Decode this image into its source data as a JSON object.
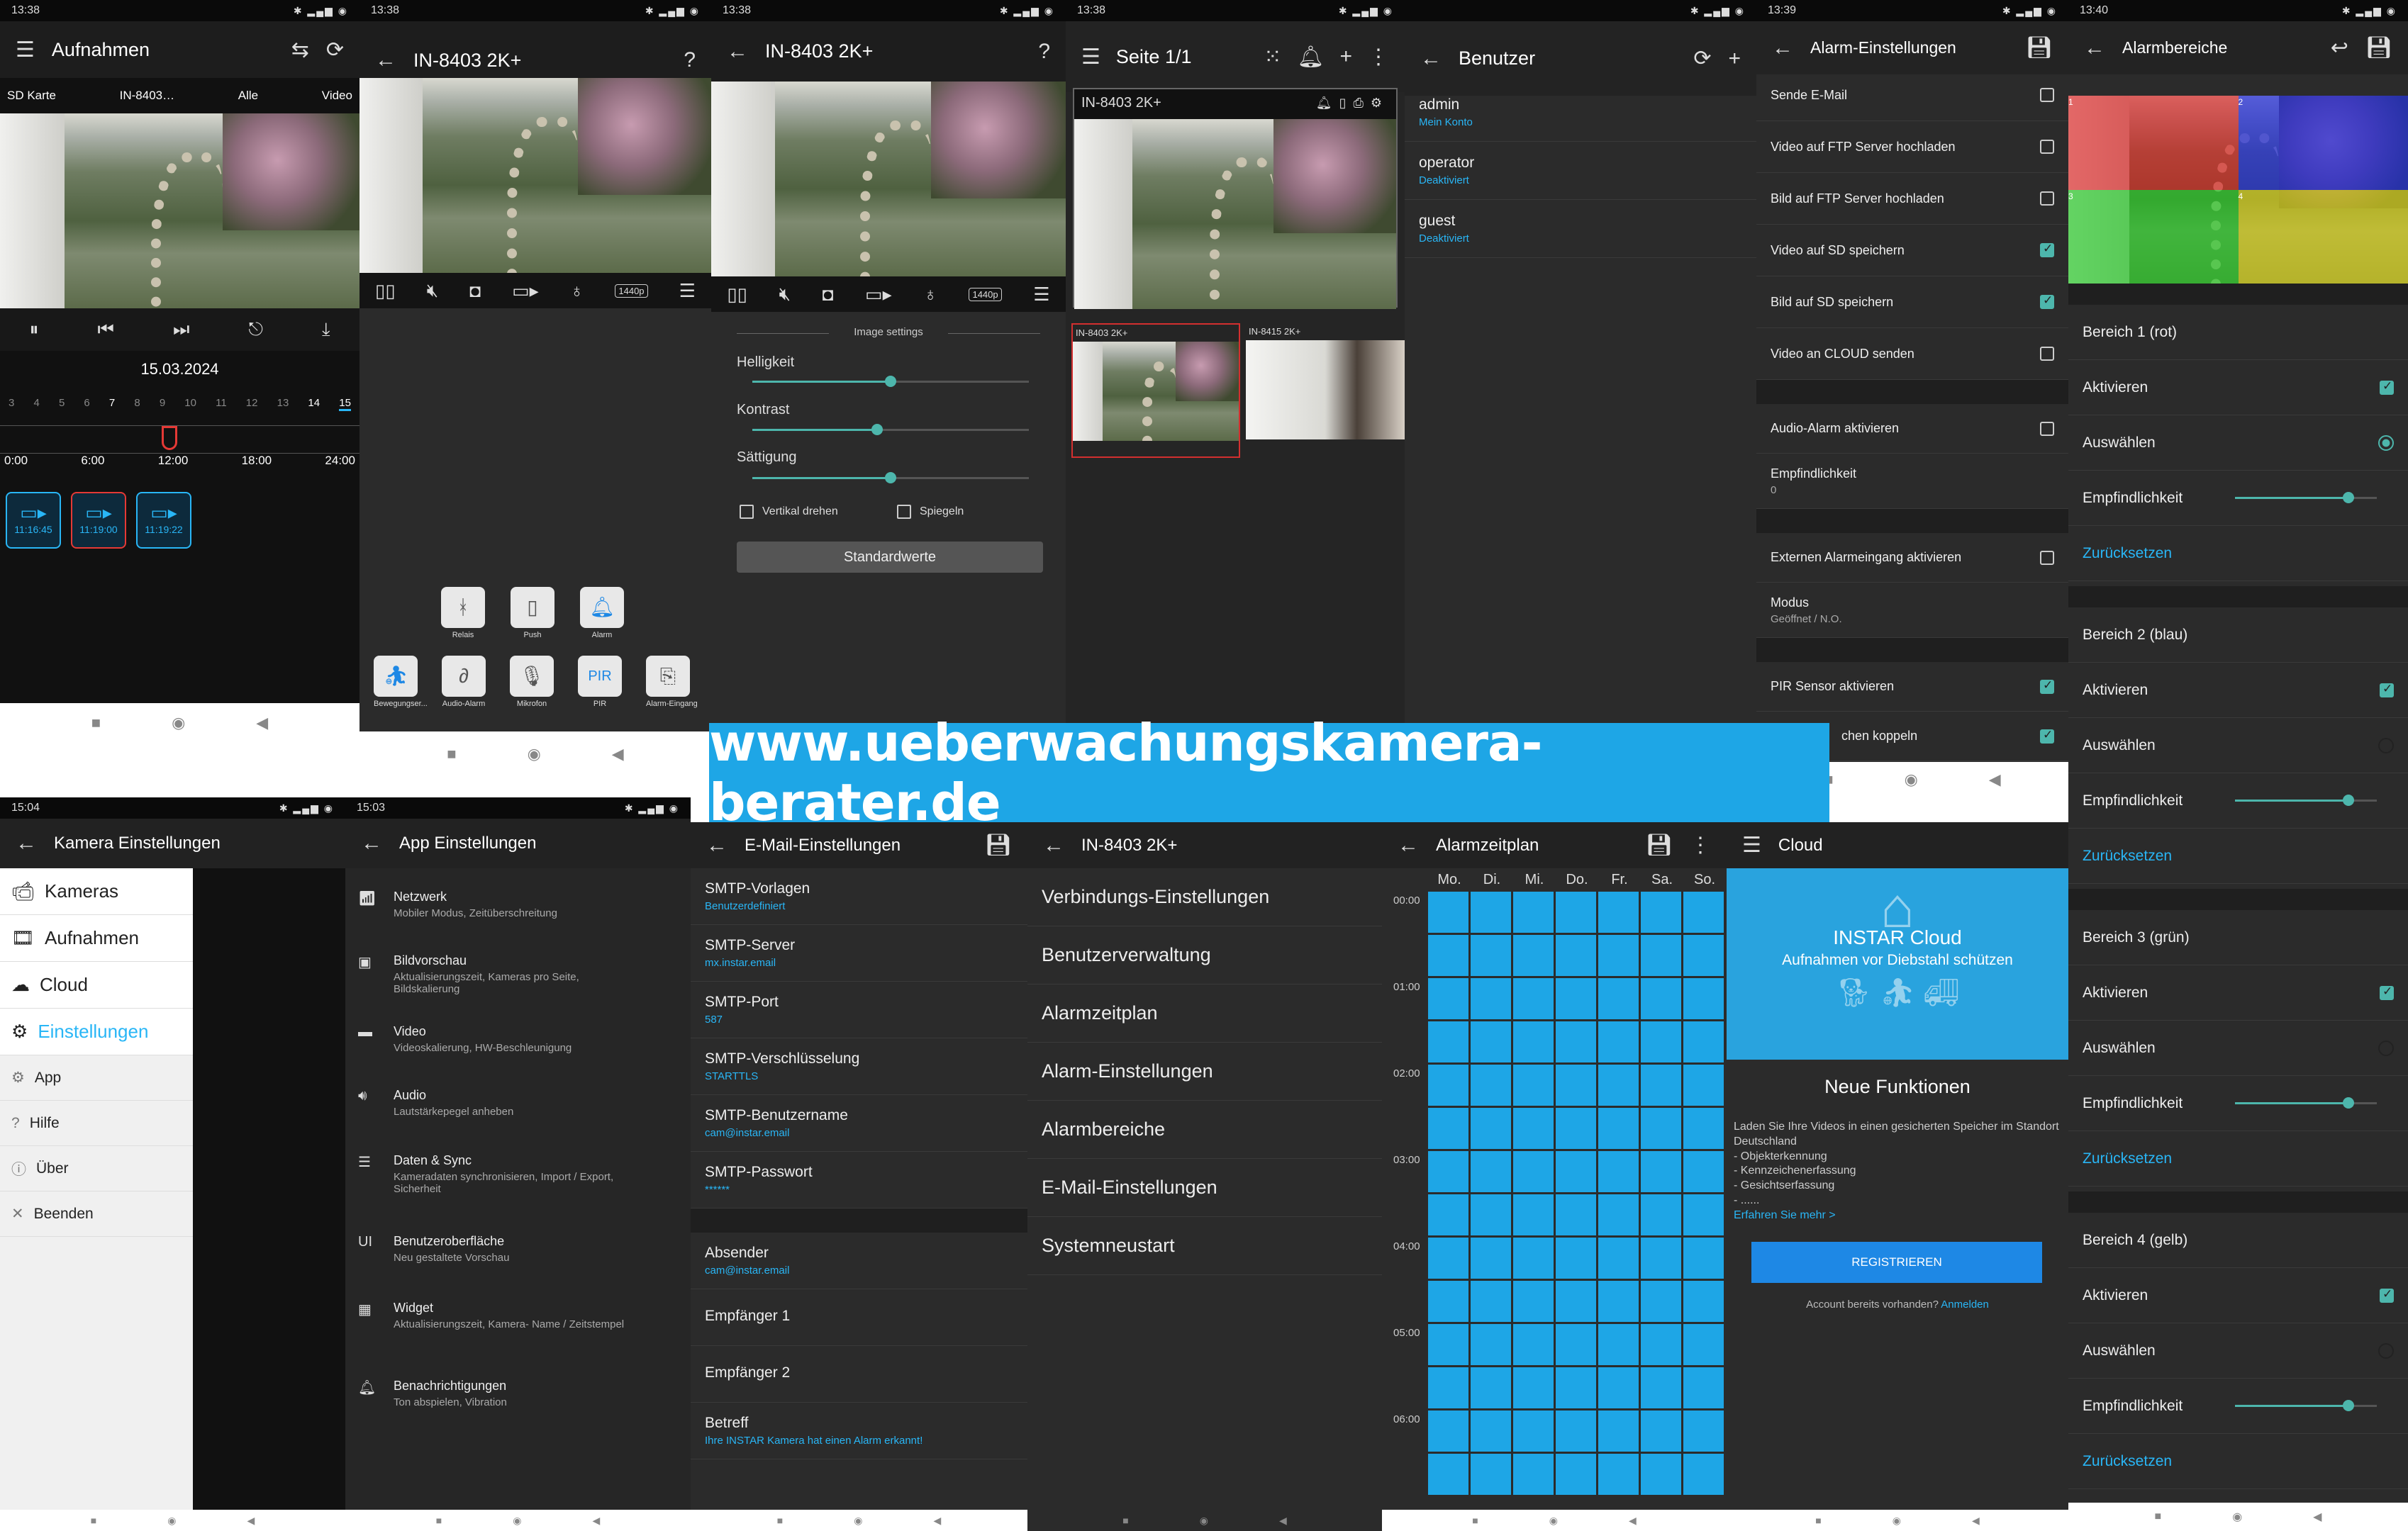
{
  "p1": {
    "time": "13:38",
    "title": "Aufnahmen",
    "filters": [
      "SD Karte",
      "IN-8403…",
      "Alle",
      "Video"
    ],
    "date": "15.03.2024",
    "days": [
      "3",
      "4",
      "5",
      "6",
      "7",
      "8",
      "9",
      "10",
      "11",
      "12",
      "13",
      "14",
      "15"
    ],
    "hours": [
      "0:00",
      "6:00",
      "12:00",
      "18:00",
      "24:00"
    ],
    "clips": [
      "11:16:45",
      "11:19:00",
      "11:19:22"
    ]
  },
  "p2": {
    "time": "13:38",
    "title": "IN-8403 2K+",
    "help": "?",
    "btn_row1": [
      "Relais",
      "Push",
      "Alarm"
    ],
    "btn_row2": [
      "Bewegungser...",
      "Audio-Alarm",
      "Mikrofon",
      "PIR",
      "Alarm-Eingang"
    ],
    "quality": "1440p"
  },
  "p3": {
    "time": "13:38",
    "title": "IN-8403 2K+",
    "help": "?",
    "section": "Image settings",
    "sliders": [
      {
        "label": "Helligkeit",
        "value": 0.5
      },
      {
        "label": "Kontrast",
        "value": 0.45
      },
      {
        "label": "Sättigung",
        "value": 0.5
      }
    ],
    "vflip": "Vertikal drehen",
    "mirror": "Spiegeln",
    "reset": "Standardwerte",
    "quality": "1440p"
  },
  "p4": {
    "time": "13:38",
    "title": "Seite 1/1",
    "cam_name": "IN-8403 2K+",
    "thumbs": [
      "IN-8403 2K+",
      "IN-8415 2K+"
    ]
  },
  "p5": {
    "time": "13:39",
    "title": "Benutzer",
    "users": [
      {
        "name": "admin",
        "sub": "Mein Konto"
      },
      {
        "name": "operator",
        "sub": "Deaktiviert"
      },
      {
        "name": "guest",
        "sub": "Deaktiviert"
      }
    ]
  },
  "p6": {
    "time": "13:39",
    "title": "Alarm-Einstellungen",
    "items": [
      {
        "label": "Sende E-Mail",
        "on": false
      },
      {
        "label": "Video auf FTP Server hochladen",
        "on": false
      },
      {
        "label": "Bild auf FTP Server hochladen",
        "on": false
      },
      {
        "label": "Video auf SD speichern",
        "on": true
      },
      {
        "label": "Bild auf SD speichern",
        "on": true
      },
      {
        "label": "Video an CLOUD senden",
        "on": false
      }
    ],
    "audio": "Audio-Alarm aktivieren",
    "sens": "Empfindlichkeit",
    "sens_val": "0",
    "ext": "Externen Alarmeingang aktivieren",
    "mode": "Modus",
    "mode_val": "Geöffnet / N.O.",
    "pir": "PIR Sensor aktivieren",
    "link": "chen koppeln"
  },
  "p7": {
    "time": "13:40",
    "title": "Alarmbereiche",
    "zones": [
      {
        "title": "Bereich 1 (rot)",
        "selected": true
      },
      {
        "title": "Bereich 2 (blau)",
        "selected": false
      },
      {
        "title": "Bereich 3 (grün)",
        "selected": false
      },
      {
        "title": "Bereich 4 (gelb)",
        "selected": false
      }
    ],
    "active": "Aktivieren",
    "select": "Auswählen",
    "sens": "Empfindlichkeit",
    "reset": "Zurücksetzen",
    "zone_nums": [
      "1",
      "2",
      "3",
      "4"
    ]
  },
  "b1": {
    "time": "15:04",
    "title": "Kamera Einstellungen",
    "menu": [
      "Kameras",
      "Aufnahmen",
      "Cloud",
      "Einstellungen",
      "App",
      "Hilfe",
      "Über",
      "Beenden"
    ]
  },
  "b2": {
    "time": "15:03",
    "title": "App Einstellungen",
    "items": [
      {
        "t": "Netzwerk",
        "s": "Mobiler Modus, Zeitüberschreitung"
      },
      {
        "t": "Bildvorschau",
        "s": "Aktualisierungszeit, Kameras pro Seite, Bildskalierung"
      },
      {
        "t": "Video",
        "s": "Videoskalierung, HW-Beschleunigung"
      },
      {
        "t": "Audio",
        "s": "Lautstärkepegel anheben"
      },
      {
        "t": "Daten & Sync",
        "s": "Kameradaten synchronisieren, Import / Export, Sicherheit"
      },
      {
        "t": "Benutzeroberfläche",
        "s": "Neu gestaltete Vorschau"
      },
      {
        "t": "Widget",
        "s": "Aktualisierungszeit, Kamera- Name / Zeitstempel"
      },
      {
        "t": "Benachrichtigungen",
        "s": "Ton abspielen, Vibration"
      }
    ]
  },
  "b3": {
    "title": "E-Mail-Einstellungen",
    "items": [
      {
        "t": "SMTP-Vorlagen",
        "s": "Benutzerdefiniert"
      },
      {
        "t": "SMTP-Server",
        "s": "mx.instar.email"
      },
      {
        "t": "SMTP-Port",
        "s": "587"
      },
      {
        "t": "SMTP-Verschlüsselung",
        "s": "STARTTLS"
      },
      {
        "t": "SMTP-Benutzername",
        "s": "cam@instar.email"
      },
      {
        "t": "SMTP-Passwort",
        "s": "******"
      }
    ],
    "items2": [
      {
        "t": "Absender",
        "s": "cam@instar.email"
      },
      {
        "t": "Empfänger 1",
        "s": ""
      },
      {
        "t": "Empfänger 2",
        "s": ""
      },
      {
        "t": "Betreff",
        "s": "Ihre INSTAR Kamera hat einen Alarm erkannt!"
      }
    ]
  },
  "b4": {
    "title": "IN-8403 2K+",
    "items": [
      "Verbindungs-Einstellungen",
      "Benutzerverwaltung",
      "Alarmzeitplan",
      "Alarm-Einstellungen",
      "Alarmbereiche",
      "E-Mail-Einstellungen",
      "Systemneustart"
    ]
  },
  "b5": {
    "title": "Alarmzeitplan",
    "days": [
      "Mo.",
      "Di.",
      "Mi.",
      "Do.",
      "Fr.",
      "Sa.",
      "So."
    ],
    "hours": [
      "00:00",
      "01:00",
      "02:00",
      "03:00",
      "04:00",
      "05:00",
      "06:00"
    ]
  },
  "b6": {
    "title": "Cloud",
    "hero1": "INSTAR Cloud",
    "hero2": "Aufnahmen vor Diebstahl schützen",
    "h": "Neue Funktionen",
    "body": "Laden Sie Ihre Videos in einen gesicherten Speicher im Standort Deutschland",
    "bullets": [
      "- Objekterkennung",
      "- Kennzeichenerfassung",
      "- Gesichtserfassung",
      "- ......"
    ],
    "more": "Erfahren Sie mehr >",
    "btn": "REGISTRIEREN",
    "acc": "Account bereits vorhanden?",
    "login": "Anmelden"
  },
  "banner": "www.ueberwachungskamera-berater.de"
}
